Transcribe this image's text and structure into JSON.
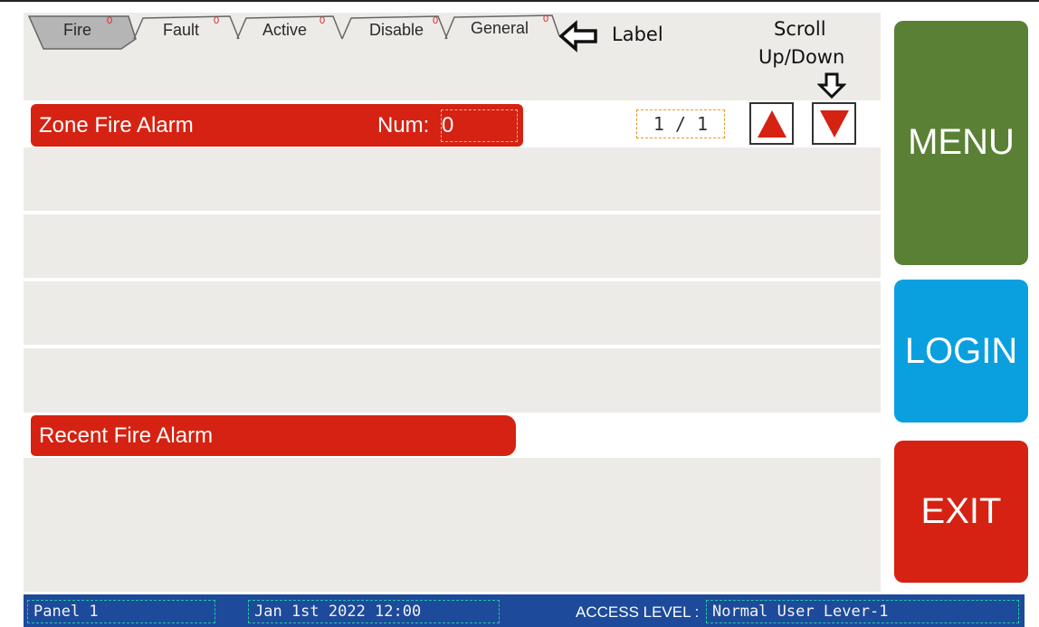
{
  "tabs": [
    {
      "label": "Fire",
      "count": "0",
      "active": true
    },
    {
      "label": "Fault",
      "count": "0",
      "active": false
    },
    {
      "label": "Active",
      "count": "0",
      "active": false
    },
    {
      "label": "Disable",
      "count": "0",
      "active": false
    },
    {
      "label": "General",
      "count": "0",
      "active": false
    }
  ],
  "annotations": {
    "label_note": "Label",
    "scroll_note_line1": "Scroll",
    "scroll_note_line2": "Up/Down"
  },
  "zone_section": {
    "title": "Zone Fire Alarm",
    "num_label": "Num:",
    "num_value": "0",
    "page_indicator": "1 / 1"
  },
  "recent_section": {
    "title": "Recent Fire Alarm"
  },
  "side_buttons": {
    "menu": "MENU",
    "login": "LOGIN",
    "exit": "EXIT"
  },
  "status_bar": {
    "panel": "Panel 1",
    "datetime": "Jan 1st 2022 12:00",
    "access_label": "ACCESS LEVEL :",
    "access_value": "Normal User Lever-1"
  },
  "colors": {
    "red": "#d52212",
    "menu_green": "#5a8035",
    "login_blue": "#0aa0e0",
    "status_blue": "#1d4a9a",
    "panel_grey": "#edebe8"
  },
  "icons": [
    "arrow-left-icon",
    "arrow-down-icon",
    "scroll-up-icon",
    "scroll-down-icon"
  ]
}
